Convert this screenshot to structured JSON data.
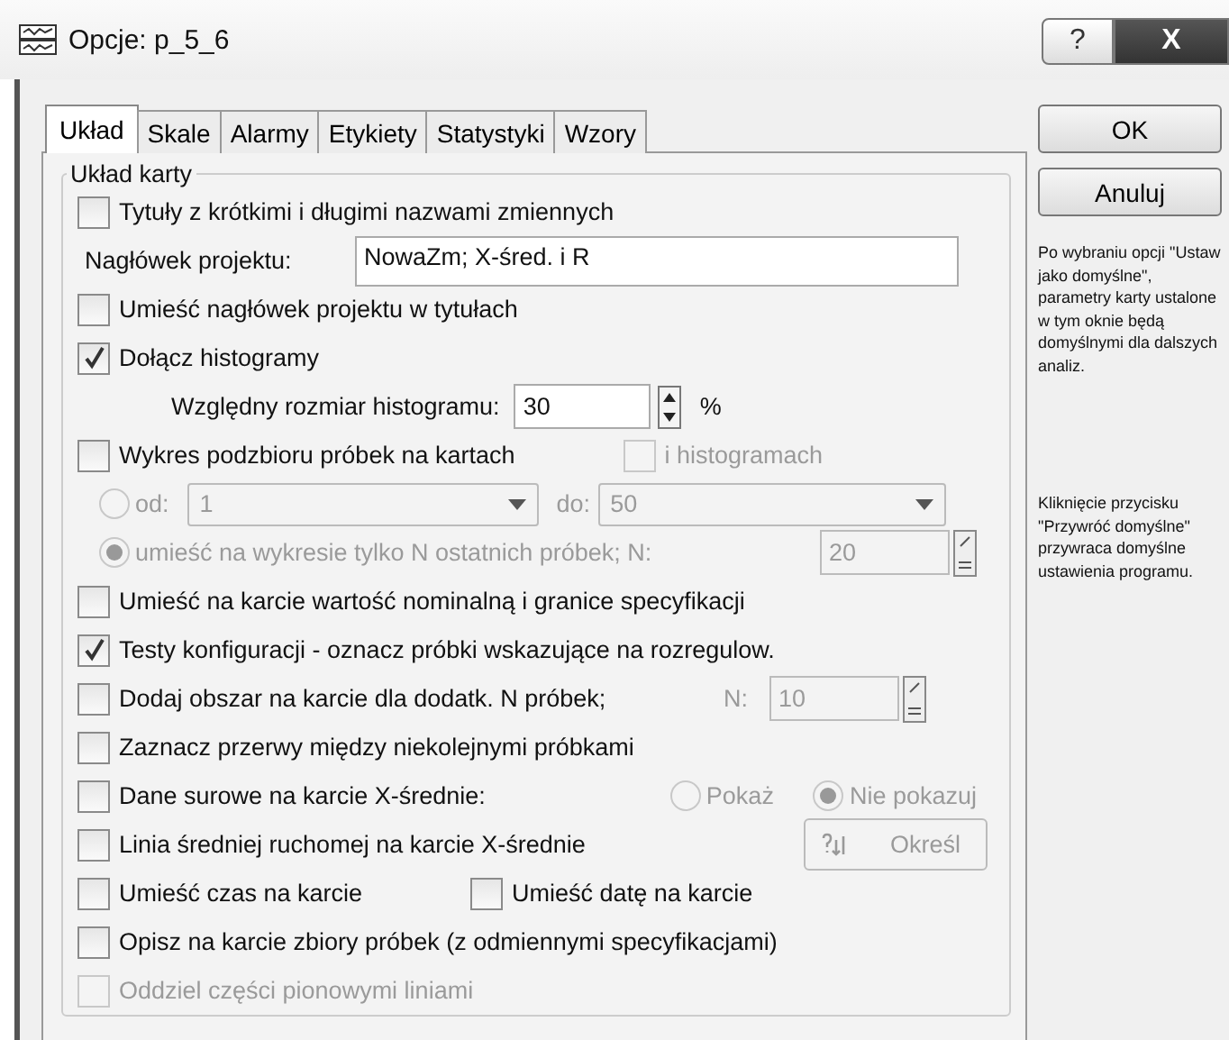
{
  "window": {
    "title": "Opcje: p_5_6",
    "help": "?",
    "close": "X"
  },
  "tabs": [
    {
      "label": "Układ",
      "selected": true
    },
    {
      "label": "Skale",
      "selected": false
    },
    {
      "label": "Alarmy",
      "selected": false
    },
    {
      "label": "Etykiety",
      "selected": false
    },
    {
      "label": "Statystyki",
      "selected": false
    },
    {
      "label": "Wzory",
      "selected": false
    }
  ],
  "group": {
    "title": "Układ karty",
    "rows": [
      {
        "kind": "check",
        "label": "Tytuły z krótkimi i długimi nazwami zmiennych",
        "checked": false,
        "disabled": false
      },
      {
        "kind": "text",
        "label": "Nagłówek projektu:",
        "value": "NowaZm; X-śred. i R"
      },
      {
        "kind": "check",
        "label": "Umieść nagłówek projektu w tytułach",
        "checked": false,
        "disabled": false
      },
      {
        "kind": "check",
        "label": "Dołącz histogramy",
        "checked": true,
        "disabled": false
      },
      {
        "kind": "spin",
        "label": "Względny rozmiar histogramu:",
        "value": "30",
        "unit": "%",
        "disabled": false
      },
      {
        "kind": "check",
        "label": "Wykres podzbioru próbek na kartach",
        "checked": false,
        "disabled": false,
        "extra": {
          "label": "i histogramach",
          "checked": false,
          "disabled": true
        }
      },
      {
        "kind": "range",
        "label": "od:",
        "selected": false,
        "disabled": true,
        "from": "1",
        "to_label": "do:",
        "to": "50"
      },
      {
        "kind": "radio_spin",
        "label": "umieść na wykresie tylko N ostatnich próbek; N:",
        "selected": true,
        "disabled": true,
        "value": "20"
      },
      {
        "kind": "check",
        "label": "Umieść na karcie wartość nominalną i granice specyfikacji",
        "checked": false,
        "disabled": false
      },
      {
        "kind": "check",
        "label": "Testy konfiguracji - oznacz próbki wskazujące na rozregulow.",
        "checked": true,
        "disabled": false
      },
      {
        "kind": "check",
        "label": "Dodaj obszar na karcie dla dodatk. N próbek;",
        "checked": false,
        "disabled": false,
        "spin": {
          "label": "N:",
          "value": "10",
          "disabled": true
        }
      },
      {
        "kind": "check",
        "label": "Zaznacz przerwy między niekolejnymi próbkami",
        "checked": false,
        "disabled": false
      },
      {
        "kind": "check",
        "label": "Dane surowe na karcie X-średnie:",
        "checked": false,
        "disabled": false,
        "radios": [
          {
            "label": "Pokaż",
            "selected": false,
            "disabled": true
          },
          {
            "label": "Nie pokazuj",
            "selected": true,
            "disabled": true
          }
        ]
      },
      {
        "kind": "check",
        "label": "Linia średniej ruchomej na karcie X-średnie",
        "checked": false,
        "disabled": false,
        "button": {
          "label": "Określ",
          "disabled": true
        }
      },
      {
        "kind": "check",
        "label": "Umieść czas na karcie",
        "checked": false,
        "disabled": false,
        "extra": {
          "label": "Umieść datę na karcie",
          "checked": false,
          "disabled": false
        }
      },
      {
        "kind": "check",
        "label": "Opisz na karcie zbiory próbek (z odmiennymi specyfikacjami)",
        "checked": false,
        "disabled": false
      },
      {
        "kind": "check",
        "label": "Oddziel części pionowymi liniami",
        "checked": false,
        "disabled": true
      }
    ]
  },
  "buttons": [
    "OK",
    "Anuluj"
  ],
  "notes": [
    "Po wybraniu opcji \"Ustaw jako domyślne\", parametry karty ustalone w tym oknie będą domyślnymi dla dalszych analiz.",
    "Kliknięcie przycisku \"Przywróć domyślne\" przywraca domyślne ustawienia programu."
  ]
}
